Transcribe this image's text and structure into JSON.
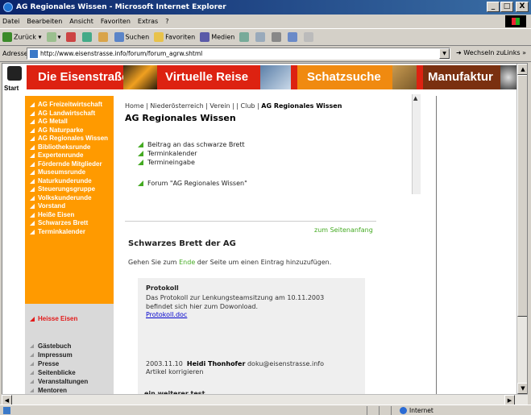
{
  "window": {
    "title": "AG Regionales Wissen - Microsoft Internet Explorer",
    "buttons": [
      "_",
      "□",
      "X"
    ]
  },
  "menubar": {
    "items": [
      "Datei",
      "Bearbeiten",
      "Ansicht",
      "Favoriten",
      "Extras",
      "?"
    ]
  },
  "toolbar": {
    "back": "Zurück",
    "search": "Suchen",
    "favorites": "Favoriten",
    "media": "Medien"
  },
  "addressbar": {
    "label": "Adresse",
    "url": "http://www.eisenstrasse.info/forum/forum_agrw.shtml",
    "go": "Wechseln zu",
    "links": "Links »"
  },
  "site": {
    "start_label": "Start",
    "nav": [
      "Die Eisenstraße",
      "Virtuelle Reise",
      "Schatzsuche",
      "Manufaktur"
    ],
    "left_menu": [
      "AG Freizeitwirtschaft",
      "AG Landwirtschaft",
      "AG Metall",
      "AG Naturparke",
      "AG Regionales Wissen",
      "Bibliotheksrunde",
      "Expertenrunde",
      "Fördernde Mitglieder",
      "Museumsrunde",
      "Naturkunderunde",
      "Steuerungsgruppe",
      "Volkskunderunde",
      "Vorstand",
      "Heiße Eisen",
      "Schwarzes Brett",
      "Terminkalender"
    ],
    "heisse_eisen": "Heisse Eisen",
    "gray_menu": [
      "Gästebuch",
      "Impressum",
      "Presse",
      "Seitenblicke",
      "Veranstaltungen",
      "Mentoren"
    ]
  },
  "content": {
    "breadcrumb_prefix": "Home | Niederösterreich | Verein | | Club | ",
    "breadcrumb_current": "AG Regionales Wissen",
    "title": "AG Regionales Wissen",
    "actions": [
      "Beitrag an das schwarze Brett",
      "Terminkalender",
      "Termineingabe"
    ],
    "forum_link": "Forum \"AG Regionales Wissen\"",
    "to_top": "zum Seitenanfang",
    "section_title": "Schwarzes Brett der AG",
    "section_text_before": "Gehen Sie zum ",
    "section_text_link": "Ende",
    "section_text_after": " der Seite um einen Eintrag hinzuzufügen.",
    "post": {
      "title": "Protokoll",
      "text_line1": "Das Protokoll zur Lenkungsteamsitzung am 10.11.2003",
      "text_line2": "befindet sich hier zum Dowonload.",
      "attachment": "Protokoll.doc"
    },
    "post_meta": {
      "date": "2003.11.10",
      "author": "Heidi Thonhofer",
      "email": "doku@eisenstrasse.info",
      "action": "Artikel korrigieren"
    },
    "next_post_title": "ein weiterer test"
  },
  "statusbar": {
    "zone": "Internet"
  },
  "colors": {
    "nav_red": "#dd2211",
    "menu_orange": "#ff9a00",
    "accent_green": "#44aa22",
    "heisse_red": "#e21a1a"
  }
}
